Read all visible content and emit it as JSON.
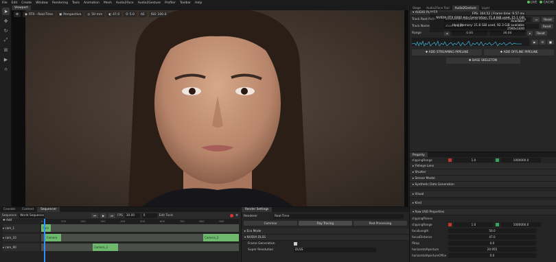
{
  "menubar": {
    "items": [
      "File",
      "Edit",
      "Create",
      "Window",
      "Rendering",
      "Tools",
      "Animation",
      "Mesh",
      "Audio2Face",
      "Audio2Gesture",
      "Profiler",
      "Toolbar",
      "Help"
    ],
    "live_label": "LIVE",
    "cache_label": "CACHE"
  },
  "viewport": {
    "tab": "Viewport",
    "render_mode": "RTX - Real-Time",
    "camera": "Perspective",
    "lens": "50 mm",
    "exposure": "47.0",
    "speed": "5.0",
    "iso": "100.0",
    "ae": "AE",
    "iso_label": "ISO",
    "stats": [
      "FPS: 104.52 | Frame time: 9.57 ms",
      "NVIDIA RTX 6000 Ada Generation: 21.4 GiB used, 15.1 GiB available",
      "Host Memory: 21.8 GiB used, 92.3 GiB available",
      "2560x1440"
    ]
  },
  "right_panel": {
    "tabs": [
      "Stage",
      "Audio2Face Tool",
      "Audio2Gesture",
      "Layer"
    ],
    "active_tab": 2,
    "audio_player": {
      "title": "AUDIO PLAYER",
      "track_root_label": "Track Root Path",
      "track_root_value": "omniverse://avatar.ov.nvidia.com/Demos/2/gtc-spring",
      "track_name_label": "Track Name",
      "track_name_value": "short 5.wav",
      "range_label": "Range",
      "range_start": "0.00",
      "range_end": "36.00",
      "reset_label": "Reset",
      "streaming_btn": "ADD STREAMING PIPELINE",
      "offline_btn": "ADD OFFLINE PIPELINE",
      "skeleton_btn": "BASE SKELETON"
    }
  },
  "property": {
    "title": "Property",
    "rows": [
      {
        "label": "clippingRange",
        "v1": "1.0",
        "v2": "1000000.0"
      },
      {
        "label": "Fisheye Lens"
      },
      {
        "label": "Shutter"
      },
      {
        "label": "Sensor Model"
      },
      {
        "label": "Synthetic Data Generation"
      },
      {
        "label": "Visual"
      },
      {
        "label": "Kind"
      },
      {
        "label": "Raw USD Properties"
      }
    ],
    "usd": [
      {
        "label": "clippingPlanes",
        "v": ""
      },
      {
        "label": "clippingRange",
        "v": "1.0",
        "v2": "1000000.0"
      },
      {
        "label": "focalLength",
        "v": "50.0"
      },
      {
        "label": "focusDistance",
        "v": "47.0"
      },
      {
        "label": "fStop",
        "v": "0.0"
      },
      {
        "label": "horizontalAperture",
        "v": "20.955"
      },
      {
        "label": "horizontalApertureOffset",
        "v": "0.0"
      }
    ]
  },
  "bottom": {
    "tabs": [
      "Console",
      "Content",
      "Sequencer"
    ],
    "active_tab": 2,
    "sequence_label": "Sequence",
    "sequence_value": "World Sequence",
    "fps_label": "FPS",
    "fps_value": "30.00",
    "frame_value": "0",
    "edit_tools": "Edit Tools",
    "add_label": "Add",
    "ruler": [
      "0",
      "100",
      "200",
      "300",
      "400",
      "500",
      "600",
      "700",
      "800",
      "900"
    ],
    "tracks": [
      {
        "name": "cam_1",
        "clips": [
          {
            "start": 0.0,
            "len": 0.05,
            "label": "Cam"
          }
        ]
      },
      {
        "name": "cam_10",
        "clips": [
          {
            "start": 0.02,
            "len": 0.08,
            "label": "Camera"
          },
          {
            "start": 0.82,
            "len": 0.18,
            "label": "Camera_2"
          }
        ]
      },
      {
        "name": "cam_90",
        "clips": [
          {
            "start": 0.26,
            "len": 0.13,
            "label": "Camera_2"
          }
        ]
      }
    ]
  },
  "render_settings": {
    "tab": "Render Settings",
    "renderer_label": "Renderer",
    "renderer_value": "Real-Time",
    "subtabs": [
      "Common",
      "Ray Tracing",
      "Post Processing"
    ],
    "active_subtab": 1,
    "sections": [
      "Eco Mode",
      "NVIDIA DLSS"
    ],
    "frame_gen_label": "Frame Generation",
    "upscale_label": "Super Resolution",
    "upscale_value": "DLSS"
  }
}
